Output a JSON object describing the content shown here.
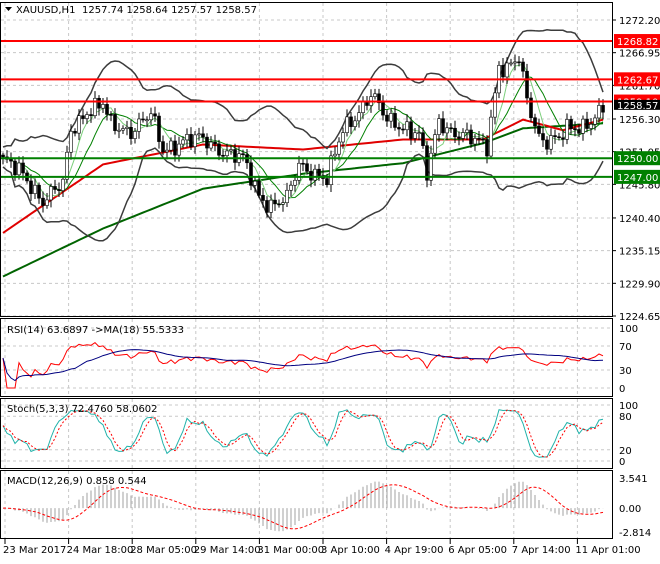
{
  "header": {
    "symbol": "XAUUSD,H1",
    "ohlc": "1257.74 1258.64 1257.57 1258.57"
  },
  "chart_data": {
    "type": "line",
    "title": "XAUUSD,H1",
    "price_axis": {
      "ylim": [
        1224.65,
        1272.2
      ],
      "ticks": [
        "1272.20",
        "1266.95",
        "1261.70",
        "1256.30",
        "1251.05",
        "1245.80",
        "1240.40",
        "1235.15",
        "1229.90",
        "1224.65"
      ]
    },
    "x_ticks": [
      "23 Mar 2017",
      "24 Mar 18:00",
      "28 Mar 05:00",
      "29 Mar 14:00",
      "31 Mar 00:00",
      "3 Apr 10:00",
      "4 Apr 19:00",
      "6 Apr 05:00",
      "7 Apr 14:00",
      "11 Apr 01:00"
    ],
    "close_waypoints": [
      [
        0,
        1249.7
      ],
      [
        5,
        1247.3
      ],
      [
        10,
        1243.3
      ],
      [
        15,
        1245.7
      ],
      [
        17,
        1254.5
      ],
      [
        21,
        1257.7
      ],
      [
        25,
        1258.5
      ],
      [
        27,
        1255.3
      ],
      [
        32,
        1254.5
      ],
      [
        37,
        1256.9
      ],
      [
        40,
        1251.3
      ],
      [
        45,
        1252.9
      ],
      [
        50,
        1252.9
      ],
      [
        55,
        1251.3
      ],
      [
        60,
        1249.7
      ],
      [
        64,
        1244.1
      ],
      [
        67,
        1242.5
      ],
      [
        71,
        1243.3
      ],
      [
        74,
        1248.9
      ],
      [
        77,
        1248.1
      ],
      [
        81,
        1246.5
      ],
      [
        85,
        1254.5
      ],
      [
        89,
        1257.7
      ],
      [
        92,
        1260.2
      ],
      [
        96,
        1256.1
      ],
      [
        100,
        1255.3
      ],
      [
        104,
        1253.7
      ],
      [
        106,
        1247.3
      ],
      [
        109,
        1256.1
      ],
      [
        112,
        1254.5
      ],
      [
        117,
        1252.9
      ],
      [
        121,
        1252.1
      ],
      [
        124,
        1265.0
      ],
      [
        126,
        1264.2
      ],
      [
        129,
        1265.8
      ],
      [
        131,
        1259.4
      ],
      [
        134,
        1253.7
      ],
      [
        136,
        1252.9
      ],
      [
        139,
        1252.9
      ],
      [
        141,
        1254.5
      ],
      [
        145,
        1255.3
      ],
      [
        150,
        1257.7
      ]
    ],
    "ma_slow_red": [
      [
        0,
        1238.0
      ],
      [
        25,
        1249.0
      ],
      [
        50,
        1252.2
      ],
      [
        75,
        1251.4
      ],
      [
        100,
        1253.0
      ],
      [
        120,
        1253.0
      ],
      [
        130,
        1256.2
      ],
      [
        140,
        1254.5
      ],
      [
        150,
        1256.2
      ]
    ],
    "ma_long_green": [
      [
        0,
        1231.0
      ],
      [
        25,
        1238.7
      ],
      [
        50,
        1245.1
      ],
      [
        75,
        1247.5
      ],
      [
        100,
        1249.2
      ],
      [
        120,
        1252.4
      ],
      [
        130,
        1254.8
      ],
      [
        150,
        1255.6
      ]
    ],
    "levels": [
      {
        "value": "1268.82",
        "color": "#ff0000"
      },
      {
        "value": "1262.67",
        "color": "#ff0000"
      },
      {
        "value": "1259.10",
        "color": "#ff0000"
      },
      {
        "value": "1250.00",
        "color": "#008000"
      },
      {
        "value": "1247.00",
        "color": "#008000"
      }
    ],
    "current_price": "1258.57",
    "rsi": {
      "label": "RSI(14) 63.6897  ->MA(18) 55.5333",
      "ticks": [
        "100",
        "70",
        "30",
        "0"
      ]
    },
    "stoch": {
      "label": "Stoch(5,3,3) 72.4760 58.0602",
      "ticks": [
        "100",
        "80",
        "20",
        "0"
      ]
    },
    "macd": {
      "label": "MACD(12,26,9) 0.858 0.544",
      "ticks": [
        "3.541",
        "0.00",
        "-2.814"
      ],
      "ylim": [
        -2.814,
        3.541
      ]
    }
  }
}
